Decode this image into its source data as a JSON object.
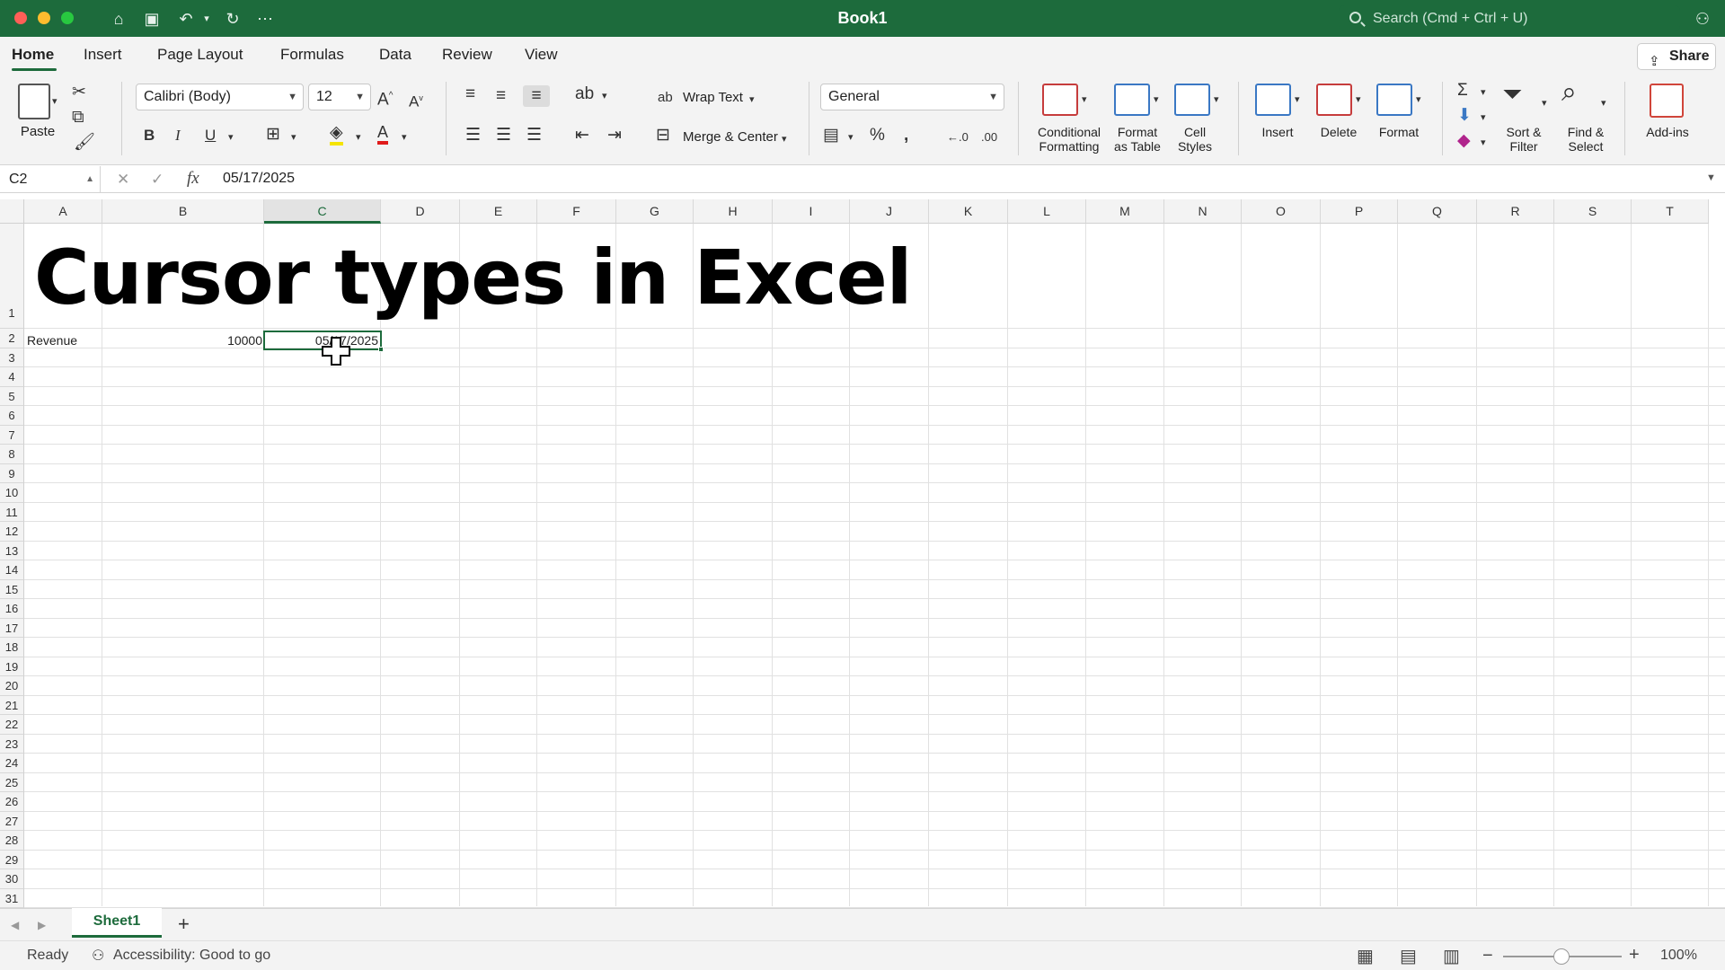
{
  "window": {
    "title": "Book1",
    "search_placeholder": "Search (Cmd + Ctrl + U)"
  },
  "menu": {
    "tabs": [
      {
        "label": "Home",
        "active": true
      },
      {
        "label": "Insert"
      },
      {
        "label": "Page Layout"
      },
      {
        "label": "Formulas"
      },
      {
        "label": "Data"
      },
      {
        "label": "Review"
      },
      {
        "label": "View"
      }
    ],
    "share_label": "Share"
  },
  "ribbon": {
    "paste_label": "Paste",
    "font_name": "Calibri (Body)",
    "font_size": "12",
    "wrap_text_label": "Wrap Text",
    "merge_center_label": "Merge & Center",
    "number_format": "General",
    "conditional_formatting_label": [
      "Conditional",
      "Formatting"
    ],
    "format_as_table_label": [
      "Format",
      "as Table"
    ],
    "cell_styles_label": [
      "Cell",
      "Styles"
    ],
    "insert_label": "Insert",
    "delete_label": "Delete",
    "format_label": "Format",
    "sort_filter_label": [
      "Sort &",
      "Filter"
    ],
    "find_select_label": [
      "Find &",
      "Select"
    ],
    "addins_label": "Add-ins",
    "accent": "#1d6b3c"
  },
  "formula_bar": {
    "name_box": "C2",
    "fx": "fx",
    "value": "05/17/2025"
  },
  "sheet": {
    "columns": [
      "A",
      "B",
      "C",
      "D",
      "E",
      "F",
      "G",
      "H",
      "I",
      "J",
      "K",
      "L",
      "M",
      "N",
      "O",
      "P",
      "Q",
      "R",
      "S",
      "T"
    ],
    "rows": [
      "1",
      "2",
      "3",
      "4",
      "5",
      "6",
      "7",
      "8",
      "9",
      "10",
      "11",
      "12",
      "13",
      "14",
      "15",
      "16",
      "17",
      "18",
      "19",
      "20",
      "21",
      "22",
      "23",
      "24",
      "25",
      "26",
      "27",
      "28",
      "29",
      "30",
      "31"
    ],
    "title": "Cursor types in Excel",
    "cells": {
      "A2": "Revenue",
      "B2": "10000",
      "C2": "05/17/2025"
    },
    "selected_cell": "C2"
  },
  "sheet_tabs": {
    "active": "Sheet1",
    "add": "+"
  },
  "status": {
    "ready": "Ready",
    "accessibility": "Accessibility: Good to go",
    "zoom": "100%"
  }
}
